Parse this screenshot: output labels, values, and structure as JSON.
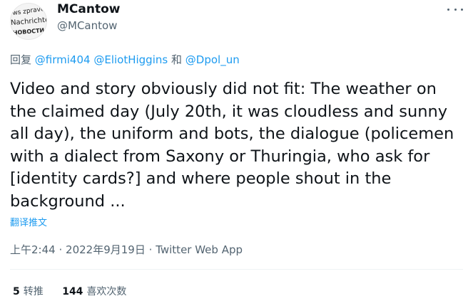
{
  "author": {
    "display_name": "MCantow",
    "handle": "@MCantow",
    "avatar_text": [
      "ws zpravo",
      "Nachrichten",
      "НОВОСТИ"
    ]
  },
  "reply": {
    "prefix": "回复",
    "mentions": [
      "@firmi404",
      "@EliotHiggins",
      "@Dpol_un"
    ],
    "conjunction": "和"
  },
  "tweet": {
    "text": "Video and story obviously did not fit: The weather on the claimed day (July 20th, it was cloudless and sunny all day), the uniform and bots, the dialogue (policemen with a dialect from Saxony or Thuringia, who ask for [identity cards?] and where people shout in the background ...",
    "translate_label": "翻译推文"
  },
  "meta": {
    "time": "上午2:44",
    "separator": "·",
    "date": "2022年9月19日",
    "source": "Twitter Web App"
  },
  "stats": {
    "retweets_count": "5",
    "retweets_label": "转推",
    "likes_count": "144",
    "likes_label": "喜欢次数"
  },
  "icons": {
    "more": "more-horizontal-icon"
  },
  "colors": {
    "link": "#1d9bf0",
    "secondary_text": "#536471",
    "primary_text": "#0f1419"
  }
}
